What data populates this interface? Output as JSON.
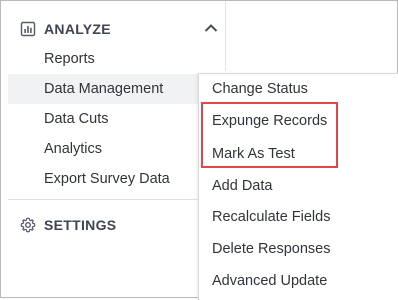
{
  "sidebar": {
    "analyze_header": {
      "label": "ANALYZE",
      "icon": "bar-chart-icon"
    },
    "items": [
      {
        "label": "Reports"
      },
      {
        "label": "Data Management"
      },
      {
        "label": "Data Cuts"
      },
      {
        "label": "Analytics"
      },
      {
        "label": "Export Survey Data"
      }
    ],
    "settings_header": {
      "label": "SETTINGS",
      "icon": "gear-icon"
    }
  },
  "submenu": {
    "items": [
      {
        "label": "Change Status"
      },
      {
        "label": "Expunge Records"
      },
      {
        "label": "Mark As Test"
      },
      {
        "label": "Add Data"
      },
      {
        "label": "Recalculate Fields"
      },
      {
        "label": "Delete Responses"
      },
      {
        "label": "Advanced Update"
      }
    ]
  },
  "colors": {
    "highlight_border": "#e0464d",
    "active_item_bg": "#f1f2f4"
  }
}
